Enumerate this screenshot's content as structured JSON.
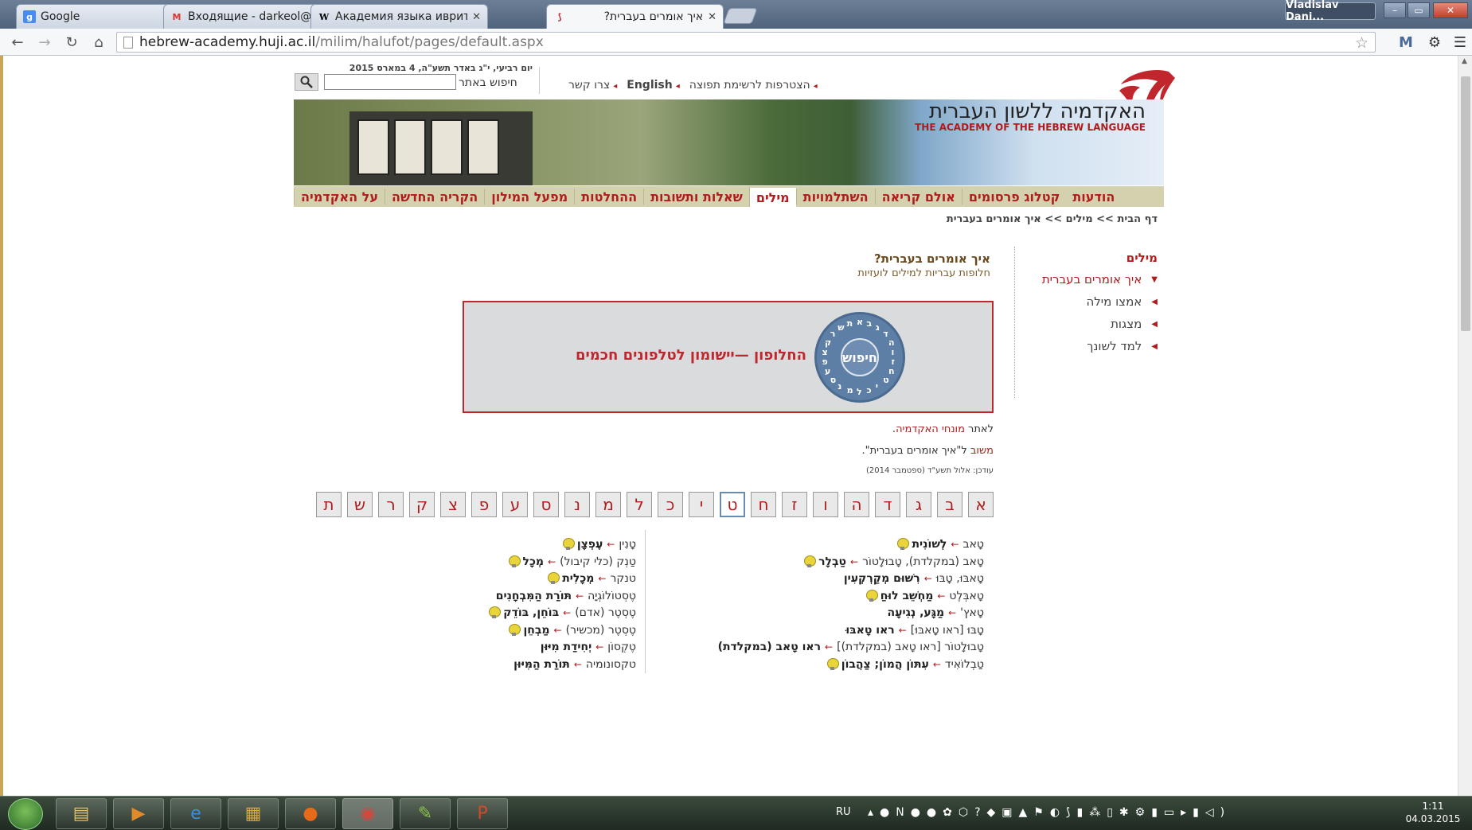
{
  "browser": {
    "tabs": [
      {
        "title": "Google",
        "favicon": "google-favicon"
      },
      {
        "title": "Входящие - darkeol@gm",
        "favicon": "gmail-favicon"
      },
      {
        "title": "Академия языка иврит –",
        "favicon": "wikipedia-favicon"
      },
      {
        "title": "איך אומרים בעברית?",
        "favicon": "academy-favicon",
        "active": true
      }
    ],
    "user": "Vladislav Dani...",
    "url_domain": "hebrew-academy.huji.ac.il",
    "url_path": "/milim/halufot/pages/default.aspx",
    "window_controls": {
      "minimize": "–",
      "maximize": "▭",
      "close": "✕"
    }
  },
  "header": {
    "date": "יום רביעי, י\"ג באדר תשע\"ה, 4 במארס 2015",
    "links": [
      "צרו קשר",
      "English",
      "הצטרפות לרשימת תפוצה"
    ],
    "search_label": "חיפוש באתר",
    "title_he": "האקדמיה ללשון העברית",
    "title_en": "THE ACADEMY OF THE HEBREW LANGUAGE"
  },
  "nav": [
    "על האקדמיה",
    "הקריה החדשה",
    "מפעל המילון",
    "ההחלטות",
    "שאלות ותשובות",
    "מילים",
    "השתלמויות",
    "אולם קריאה",
    "קטלוג פרסומים",
    "הודעות"
  ],
  "nav_active_index": 5,
  "breadcrumb": [
    "דף הבית",
    "מילים",
    "איך אומרים בעברית"
  ],
  "breadcrumb_sep": ">>",
  "sidebar": {
    "title": "מילים",
    "items": [
      "איך אומרים בעברית",
      "אמצו מילה",
      "מצגות",
      "למד לשונך"
    ]
  },
  "main": {
    "title": "איך אומרים בעברית?",
    "subtitle": "חלופות עבריות למילים לועזיות",
    "promo_dial_center": "חיפוש",
    "promo_dial_ring": "אבגדהוזחטיכלמנסעפצקרשת",
    "promo_text": "החלופון —יישומון לטלפונים חכמים",
    "note1_link": "מונחי האקדמיה",
    "note1_prefix": "לאתר ",
    "note1_suffix": ".",
    "note2_link": "משוב",
    "note2_rest": " ל\"איך אומרים בעברית\".",
    "updated": "עודכן: אלול תשע\"ד (ספטמבר 2014)"
  },
  "alphabet": [
    "א",
    "ב",
    "ג",
    "ד",
    "ה",
    "ו",
    "ז",
    "ח",
    "ט",
    "י",
    "כ",
    "ל",
    "מ",
    "נ",
    "ס",
    "ע",
    "פ",
    "צ",
    "ק",
    "ר",
    "ש",
    "ת"
  ],
  "alphabet_active": "ט",
  "arrow": "←",
  "entries_right": [
    {
      "src": "טָאב",
      "tgt": "לְשׁוֹנִית",
      "bulb": true
    },
    {
      "src": "טָאב (במקלדת), טָבוּלָטוֹר",
      "tgt": "טַבְלָר",
      "bulb": true
    },
    {
      "src": "טָאבּוּ, טָבּוּ",
      "tgt": "רִשּׁוּם מְקַרְקְעִין",
      "bulb": false
    },
    {
      "src": "טָאבְּלֶט",
      "tgt": "מַחְשֵׁב לוּחַ",
      "bulb": true
    },
    {
      "src": "טָאץ'",
      "tgt": "מַגָּע, נְגִיעָה",
      "bulb": false
    },
    {
      "src": "טָבּוּ [ראו טָאבּוּ]",
      "tgt": "ראו טָאבּוּ",
      "bulb": false
    },
    {
      "src": "טָבוּלָטוֹר [ראו טָאב (במקלדת)]",
      "tgt": "ראו טָאב (במקלדת)",
      "bulb": false
    },
    {
      "src": "טַבְלוֹאִיד",
      "tgt": "עִתּוֹן הֲמוֹן; צַהֲבוֹן",
      "bulb": true
    }
  ],
  "entries_left": [
    {
      "src": "טָנִין",
      "tgt": "עֶפְצָן",
      "bulb": true
    },
    {
      "src": "טַנְק (כלי קיבול)",
      "tgt": "מְכָל",
      "bulb": true
    },
    {
      "src": "טנקר",
      "tgt": "מְכָלִית",
      "bulb": true
    },
    {
      "src": "טֶסְטוֹלוֹגְיָה",
      "tgt": "תּוֹרַת הַמִּבְחָנִים",
      "bulb": false
    },
    {
      "src": "טֶסְטֶר (אדם)",
      "tgt": "בּוֹחֵן, בּוֹדֵק",
      "bulb": true
    },
    {
      "src": "טֶסְטֶר (מכשיר)",
      "tgt": "מַבְחֵן",
      "bulb": true
    },
    {
      "src": "טֶקְסוֹן",
      "tgt": "יְחִידַת מִיּוּן",
      "bulb": false
    },
    {
      "src": "טקסונומיה",
      "tgt": "תּוֹרַת הַמִּיּוּן",
      "bulb": false
    }
  ],
  "taskbar": {
    "lang": "RU",
    "time": "1:11",
    "date": "04.03.2015"
  },
  "colors": {
    "brand_red": "#b01c1c",
    "nav_bg": "#d4d2ae",
    "promo_border": "#c0272d"
  }
}
